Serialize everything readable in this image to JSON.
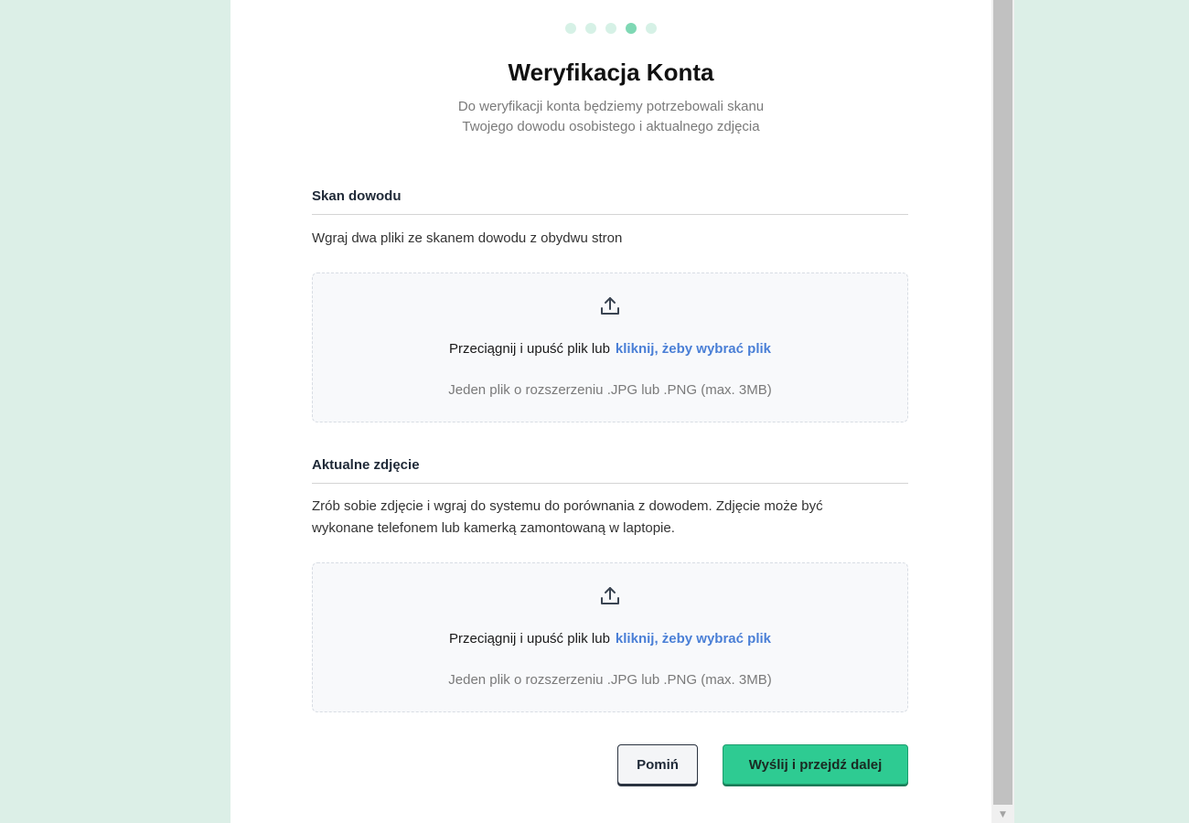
{
  "stepper": {
    "total": 5,
    "current": 4
  },
  "header": {
    "title": "Weryfikacja Konta",
    "subtitle_line1": "Do weryfikacji konta będziemy potrzebowali skanu",
    "subtitle_line2": "Twojego dowodu osobistego i aktualnego zdjęcia"
  },
  "id_scan": {
    "heading": "Skan dowodu",
    "description": "Wgraj dwa pliki ze skanem dowodu z obydwu stron",
    "dropzone": {
      "icon": "upload-icon",
      "text": "Przeciągnij i upuść plik lub",
      "link": "kliknij, żeby wybrać plik",
      "hint": "Jeden plik o rozszerzeniu .JPG lub .PNG (max. 3MB)"
    }
  },
  "photo": {
    "heading": "Aktualne zdjęcie",
    "description_line1": "Zrób sobie zdjęcie i wgraj do systemu do porównania z dowodem. Zdjęcie może być",
    "description_line2": "wykonane telefonem lub kamerką zamontowaną w laptopie.",
    "dropzone": {
      "icon": "upload-icon",
      "text": "Przeciągnij i upuść plik lub",
      "link": "kliknij, żeby wybrać plik",
      "hint": "Jeden plik o rozszerzeniu .JPG lub .PNG (max. 3MB)"
    }
  },
  "actions": {
    "skip_label": "Pomiń",
    "submit_label": "Wyślij i przejdź dalej"
  },
  "colors": {
    "background": "#dcefe7",
    "accent": "#2ecb92",
    "link": "#4a7fd6",
    "step_active": "#7fd8b4",
    "step_inactive": "#d6f1e6"
  }
}
